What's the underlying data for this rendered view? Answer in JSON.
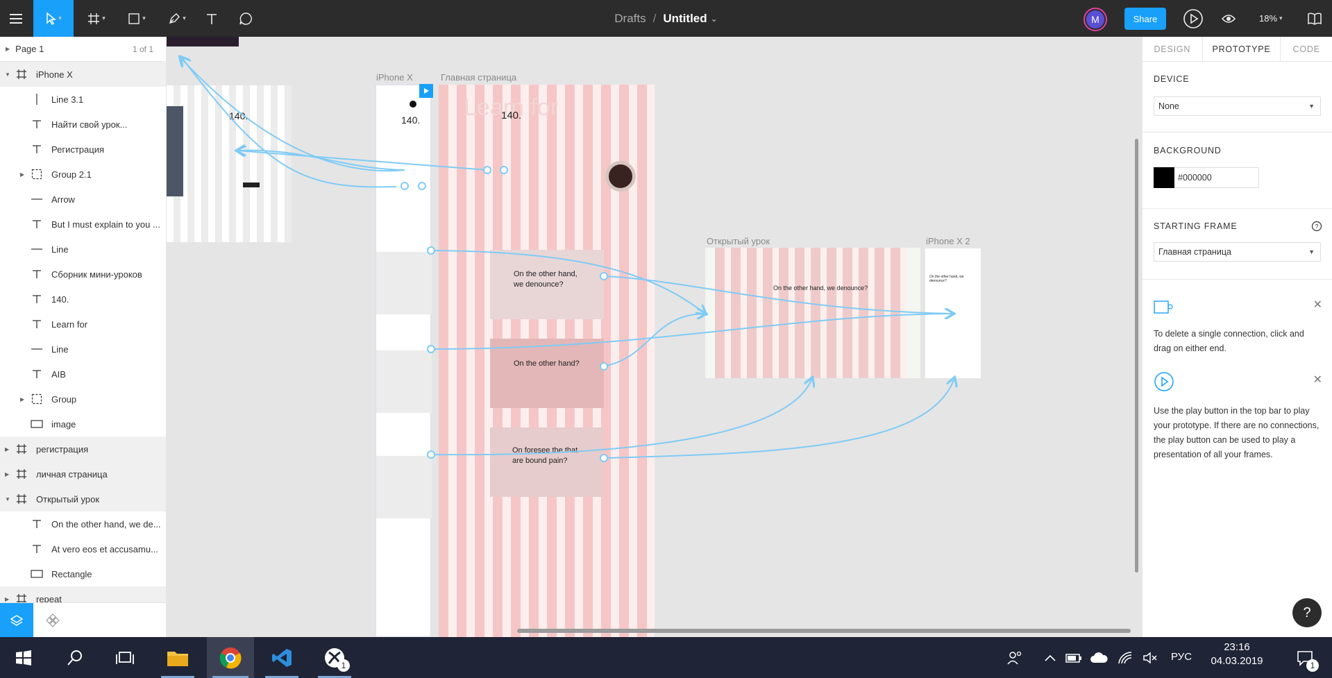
{
  "topbar": {
    "breadcrumb": "Drafts",
    "separator": "/",
    "title": "Untitled",
    "title_caret": "⌄",
    "avatar_initial": "M",
    "share_label": "Share",
    "zoom": "18%",
    "accent_color": "#18a0fb"
  },
  "leftpanel": {
    "page_name": "Page 1",
    "page_count": "1 of 1",
    "layers": [
      {
        "label": "iPhone X",
        "type": "frame"
      },
      {
        "label": "Line 3.1",
        "type": "vline"
      },
      {
        "label": "Найти свой урок...",
        "type": "text"
      },
      {
        "label": "Регистрация",
        "type": "text"
      },
      {
        "label": "Group 2.1",
        "type": "group"
      },
      {
        "label": "Arrow",
        "type": "line"
      },
      {
        "label": "But I must explain to you ...",
        "type": "text"
      },
      {
        "label": "Line",
        "type": "line"
      },
      {
        "label": "Сборник мини-уроков",
        "type": "text"
      },
      {
        "label": "140.",
        "type": "text"
      },
      {
        "label": "Learn for",
        "type": "text"
      },
      {
        "label": "Line",
        "type": "line"
      },
      {
        "label": "AIB",
        "type": "text"
      },
      {
        "label": "Group",
        "type": "group"
      },
      {
        "label": "image",
        "type": "rect"
      },
      {
        "label": "регистрация",
        "type": "frame"
      },
      {
        "label": "личная страница",
        "type": "frame"
      },
      {
        "label": "Открытый урок",
        "type": "frame"
      },
      {
        "label": "On the other hand, we de...",
        "type": "text"
      },
      {
        "label": "At vero eos et accusamu...",
        "type": "text"
      },
      {
        "label": "Rectangle",
        "type": "rect"
      },
      {
        "label": "repeat",
        "type": "frame"
      }
    ]
  },
  "canvas": {
    "frames": {
      "iphone_x": "iPhone X",
      "main_page": "Главная страница",
      "open_lesson": "Открытый урок",
      "iphone_x2": "iPhone X 2"
    },
    "texts": {
      "n140a": "140.",
      "n140b": "140.",
      "n140c": "140.",
      "learn_for": "Learn for",
      "card1": "On the other hand, we denounce?",
      "card2": "On the other hand?",
      "card3": "On foresee the that are bound pain?",
      "lesson_heading": "On the other hand, we denounce?",
      "small_card": "On the other hand, we denounce?"
    }
  },
  "rightpanel": {
    "tabs": [
      "DESIGN",
      "PROTOTYPE",
      "CODE"
    ],
    "device_label": "DEVICE",
    "device_value": "None",
    "background_label": "BACKGROUND",
    "background_hex": "#000000",
    "starting_frame_label": "STARTING FRAME",
    "starting_frame_value": "Главная страница",
    "tip1": "To delete a single connection, click and drag on either end.",
    "tip2": "Use the play button in the top bar to play your prototype. If there are no connections, the play button can be used to play a presentation of all your frames.",
    "help": "?"
  },
  "taskbar": {
    "language": "РУС",
    "time": "23:16",
    "date": "04.03.2019",
    "notif_count": "1",
    "xbox_badge": "1"
  }
}
